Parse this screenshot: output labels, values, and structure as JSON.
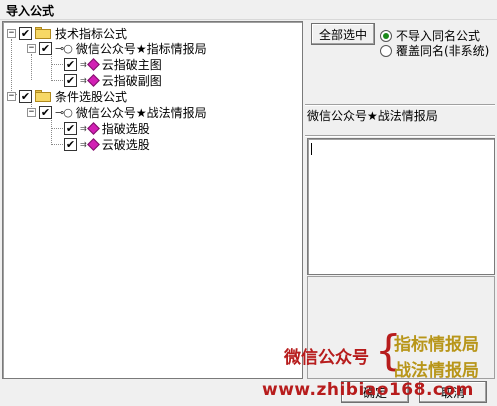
{
  "window": {
    "title": "导入公式"
  },
  "tree": {
    "nodes": [
      {
        "label": "技术指标公式",
        "checked": true,
        "expander": "−",
        "icon": "folder-icon"
      },
      {
        "label": "微信公众号★指标情报局",
        "checked": true,
        "expander": "−",
        "icon": "key-icon"
      },
      {
        "label": "云指破主图",
        "checked": true,
        "icon": "formula-gem-icon"
      },
      {
        "label": "云指破副图",
        "checked": true,
        "icon": "formula-gem-icon"
      },
      {
        "label": "条件选股公式",
        "checked": true,
        "expander": "−",
        "icon": "folder-icon"
      },
      {
        "label": "微信公众号★战法情报局",
        "checked": true,
        "expander": "−",
        "icon": "key-icon"
      },
      {
        "label": "指破选股",
        "checked": true,
        "icon": "formula-gem-icon"
      },
      {
        "label": "云破选股",
        "checked": true,
        "icon": "formula-gem-icon"
      }
    ]
  },
  "controls": {
    "select_all_label": "全部选中",
    "radio_no_import_label": "不导入同名公式",
    "radio_overwrite_label": "覆盖同名(非系统)",
    "selected_radio": "no_import",
    "confirm_label": "确定",
    "cancel_label": "取消"
  },
  "detail": {
    "selected_name": "微信公众号★战法情报局",
    "description": ""
  },
  "watermark": {
    "left_text": "微信公众号",
    "brace": "{",
    "right_line1": "指标情报局",
    "right_line2": "战法情报局",
    "url": "www.zhibiao168.com"
  },
  "colors": {
    "checkmark_green": "#1c8a1c",
    "watermark_red": "#b71c1c",
    "watermark_gold": "#b8961a",
    "gem_magenta": "#d21fb4",
    "folder_yellow": "#f7d865"
  }
}
